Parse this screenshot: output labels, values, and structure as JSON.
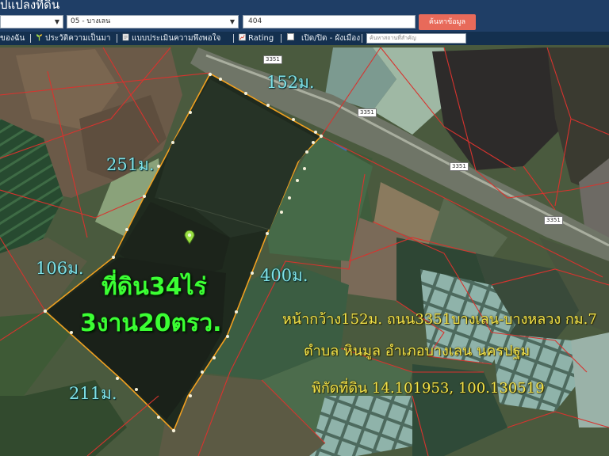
{
  "header": {
    "title": "ปแปลงที่ดิน"
  },
  "search_form": {
    "province_value": "",
    "district_value": "05 - บางเลน",
    "parcel_value": "404",
    "search_button": "ค้นหาข้อมูล"
  },
  "toolbar": {
    "items": [
      {
        "label": "ของฉัน"
      },
      {
        "label": "ประวัติความเป็นมา"
      },
      {
        "label": "แบบประเมินความพึงพอใจ"
      },
      {
        "label": "Rating"
      },
      {
        "label": "เปิด/ปิด - ผังเมือง"
      }
    ],
    "place_search_placeholder": "ค้นหาสถานที่สำคัญ"
  },
  "map": {
    "road_badges": [
      "3351",
      "3351",
      "3351",
      "3351"
    ],
    "dimensions": {
      "north": "152ม.",
      "northwest": "251ม.",
      "west": "106ม.",
      "east": "400ม.",
      "south": "211ม."
    },
    "area": {
      "line1": "ที่ดิน34ไร่",
      "line2": "3งาน20ตรว."
    },
    "info": {
      "line1": "หน้ากว้าง152ม. ถนน3351บางเลน-บางหลวง กม.7",
      "line2": "ตำบล หินมูล อำเภอบางเลน นครปฐม",
      "line3": "พิกัดที่ดิน 14.101953, 100.130519"
    },
    "colors": {
      "parcel_outline": "#f0a020",
      "parcel_fill": "#1f2a1e",
      "cadastral_lines": "#d8332e",
      "dimension_text": "#7ee0e6",
      "area_text": "#3bff33",
      "info_text": "#f2e24a"
    }
  }
}
